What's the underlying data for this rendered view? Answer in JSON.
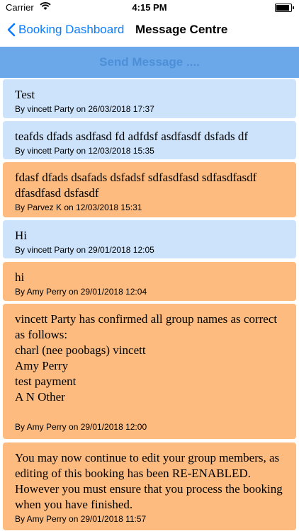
{
  "status_bar": {
    "carrier": "Carrier",
    "time": "4:15 PM",
    "battery_level": 0.9
  },
  "nav": {
    "back_label": "Booking Dashboard",
    "title": "Message Centre"
  },
  "send_button": {
    "label": "Send Message ...."
  },
  "colors": {
    "sent_bg": "#cce3fb",
    "received_bg": "#fdbb80",
    "accent": "#0a7bff"
  },
  "messages": [
    {
      "text": "Test",
      "byline": "By vincett Party on 26/03/2018 17:37",
      "style": "blue"
    },
    {
      "text": "teafds dfads asdfasd fd adfdsf asdfasdf dsfads df",
      "byline": "By vincett Party on 12/03/2018 15:35",
      "style": "blue"
    },
    {
      "text": "fdasf dfads dsafads dsfadsf sdfasdfasd sdfasdfasdf dfasdfasd dsfasdf",
      "byline": "By Parvez K on 12/03/2018 15:31",
      "style": "orange"
    },
    {
      "text": "Hi",
      "byline": "By vincett Party on 29/01/2018 12:05",
      "style": "blue"
    },
    {
      "text": "hi",
      "byline": "By Amy Perry on 29/01/2018 12:04",
      "style": "orange"
    },
    {
      "text": "vincett Party has confirmed all group names as correct as follows:\ncharl (nee poobags) vincett\nAmy Perry\ntest payment\nA N Other\n\n",
      "byline": "By Amy Perry on 29/01/2018 12:00",
      "style": "orange"
    },
    {
      "text": "You may now continue to edit your group members, as editing of this booking has been RE-ENABLED. However you must ensure that you process the booking when you have finished.",
      "byline": "By Amy Perry on 29/01/2018 11:57",
      "style": "orange"
    }
  ]
}
